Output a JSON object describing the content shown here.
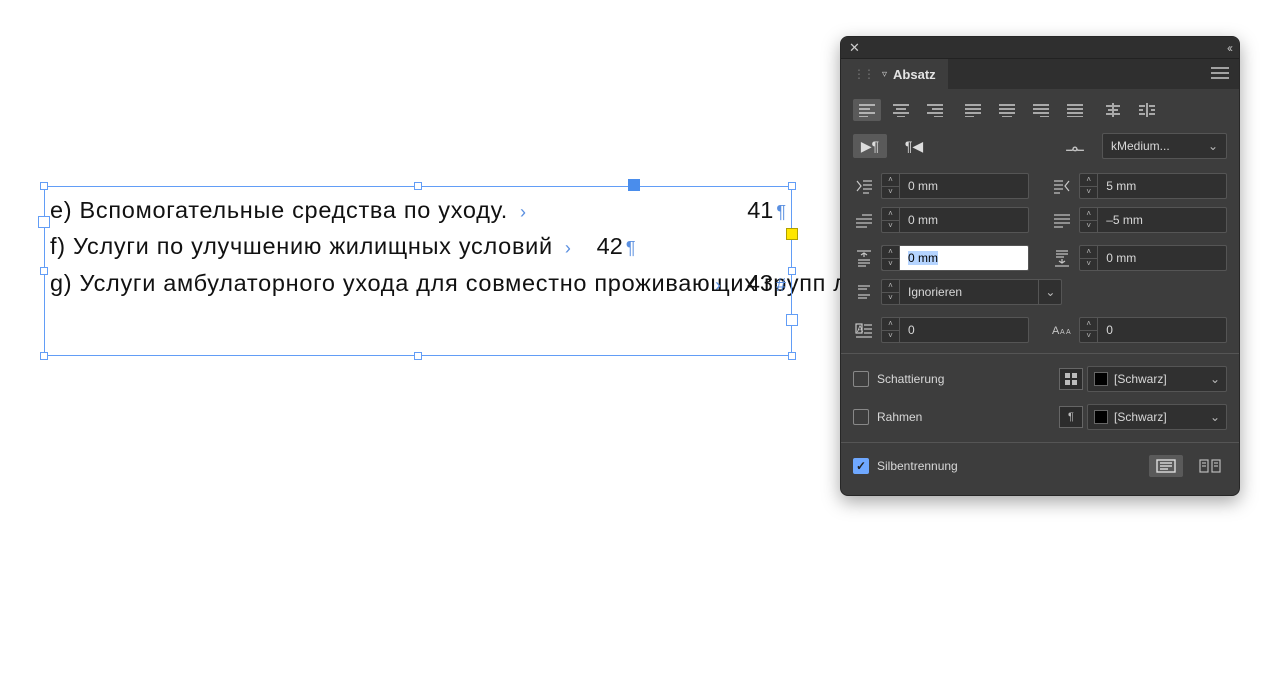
{
  "text_frame": {
    "lines": [
      {
        "text": "e) Вспомогательные средства по уходу.",
        "page": "41"
      },
      {
        "text": "f) Услуги по улучшению жилищных условий",
        "page": "42"
      },
      {
        "text": "g) Услуги амбулаторного ухода для совместно проживающих групп людей",
        "page": "43"
      }
    ]
  },
  "panel": {
    "title": "Absatz",
    "kashida_label": "kMedium...",
    "indent_left": "0 mm",
    "indent_right": "5 mm",
    "first_line": "0 mm",
    "last_line": "–5 mm",
    "space_before": "0 mm",
    "space_after": "0 mm",
    "same_style": "Ignorieren",
    "drop_lines": "0",
    "drop_chars": "0",
    "shading_label": "Schattierung",
    "border_label": "Rahmen",
    "shading_swatch": "[Schwarz]",
    "border_swatch": "[Schwarz]",
    "hyphenation_label": "Silbentrennung"
  }
}
